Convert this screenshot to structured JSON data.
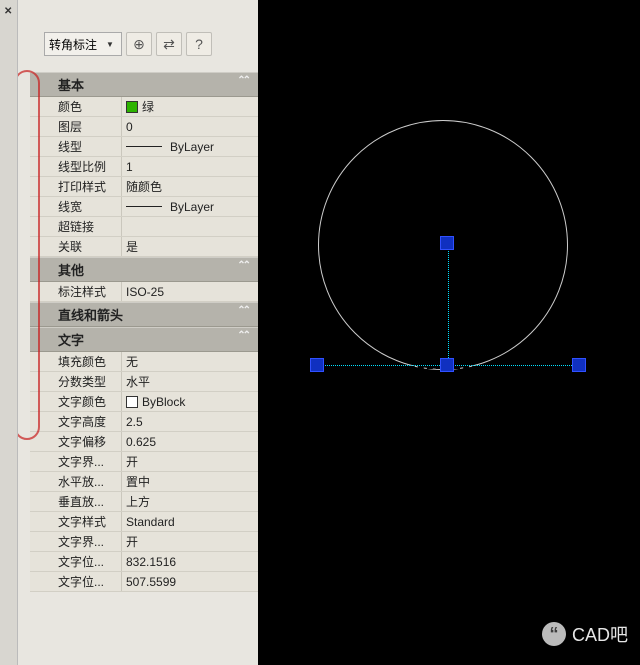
{
  "toolbar": {
    "dropdown_label": "转角标注",
    "btn_a": "⊕",
    "btn_b": "⇄",
    "btn_c": "?"
  },
  "sections": {
    "basic": {
      "title": "基本",
      "rows": [
        {
          "label": "颜色",
          "swatch": "#2db300",
          "value": "绿"
        },
        {
          "label": "图层",
          "value": "0"
        },
        {
          "label": "线型",
          "preview": true,
          "value": "ByLayer"
        },
        {
          "label": "线型比例",
          "value": "1"
        },
        {
          "label": "打印样式",
          "value": "随颜色"
        },
        {
          "label": "线宽",
          "preview": true,
          "value": "ByLayer"
        },
        {
          "label": "超链接",
          "value": ""
        },
        {
          "label": "关联",
          "value": "是"
        }
      ]
    },
    "other": {
      "title": "其他",
      "rows": [
        {
          "label": "标注样式",
          "value": "ISO-25"
        }
      ]
    },
    "lines": {
      "title": "直线和箭头",
      "rows": []
    },
    "text": {
      "title": "文字",
      "rows": [
        {
          "label": "填充颜色",
          "value": "无"
        },
        {
          "label": "分数类型",
          "value": "水平"
        },
        {
          "label": "文字颜色",
          "swatch": "#ffffff",
          "value": "ByBlock"
        },
        {
          "label": "文字高度",
          "value": "2.5"
        },
        {
          "label": "文字偏移",
          "value": "0.625"
        },
        {
          "label": "文字界...",
          "value": "开"
        },
        {
          "label": "水平放...",
          "value": "置中"
        },
        {
          "label": "垂直放...",
          "value": "上方"
        },
        {
          "label": "文字样式",
          "value": "Standard"
        },
        {
          "label": "文字界...",
          "value": "开"
        },
        {
          "label": "文字位...",
          "value": "832.1516"
        },
        {
          "label": "文字位...",
          "value": "507.5599"
        }
      ]
    }
  },
  "watermark": "CAD吧"
}
